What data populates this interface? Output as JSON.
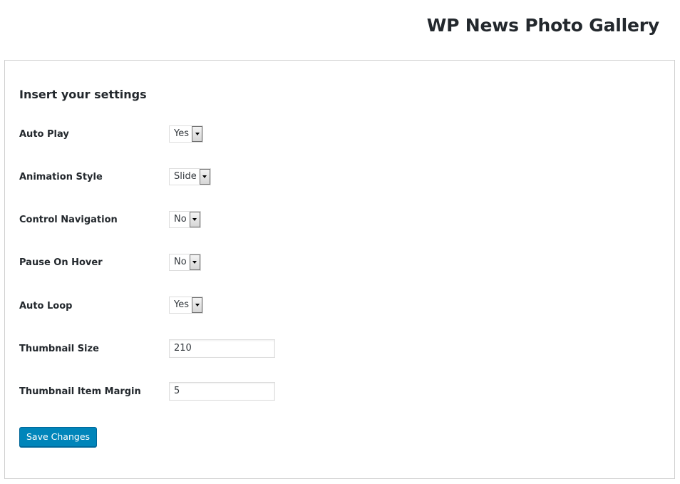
{
  "page": {
    "title": "WP News Photo Gallery"
  },
  "settings": {
    "heading": "Insert your settings",
    "rows": [
      {
        "label": "Auto Play",
        "value": "Yes"
      },
      {
        "label": "Animation Style",
        "value": "Slide"
      },
      {
        "label": "Control Navigation",
        "value": "No"
      },
      {
        "label": "Pause On Hover",
        "value": "No"
      },
      {
        "label": "Auto Loop",
        "value": "Yes"
      },
      {
        "label": "Thumbnail Size",
        "value": "210"
      },
      {
        "label": "Thumbnail Item Margin",
        "value": "5"
      }
    ],
    "save_label": "Save Changes"
  },
  "colors": {
    "primary_button": "#0085ba",
    "text": "#23282d"
  },
  "icons": {
    "select_arrow": "chevron-down-icon"
  }
}
